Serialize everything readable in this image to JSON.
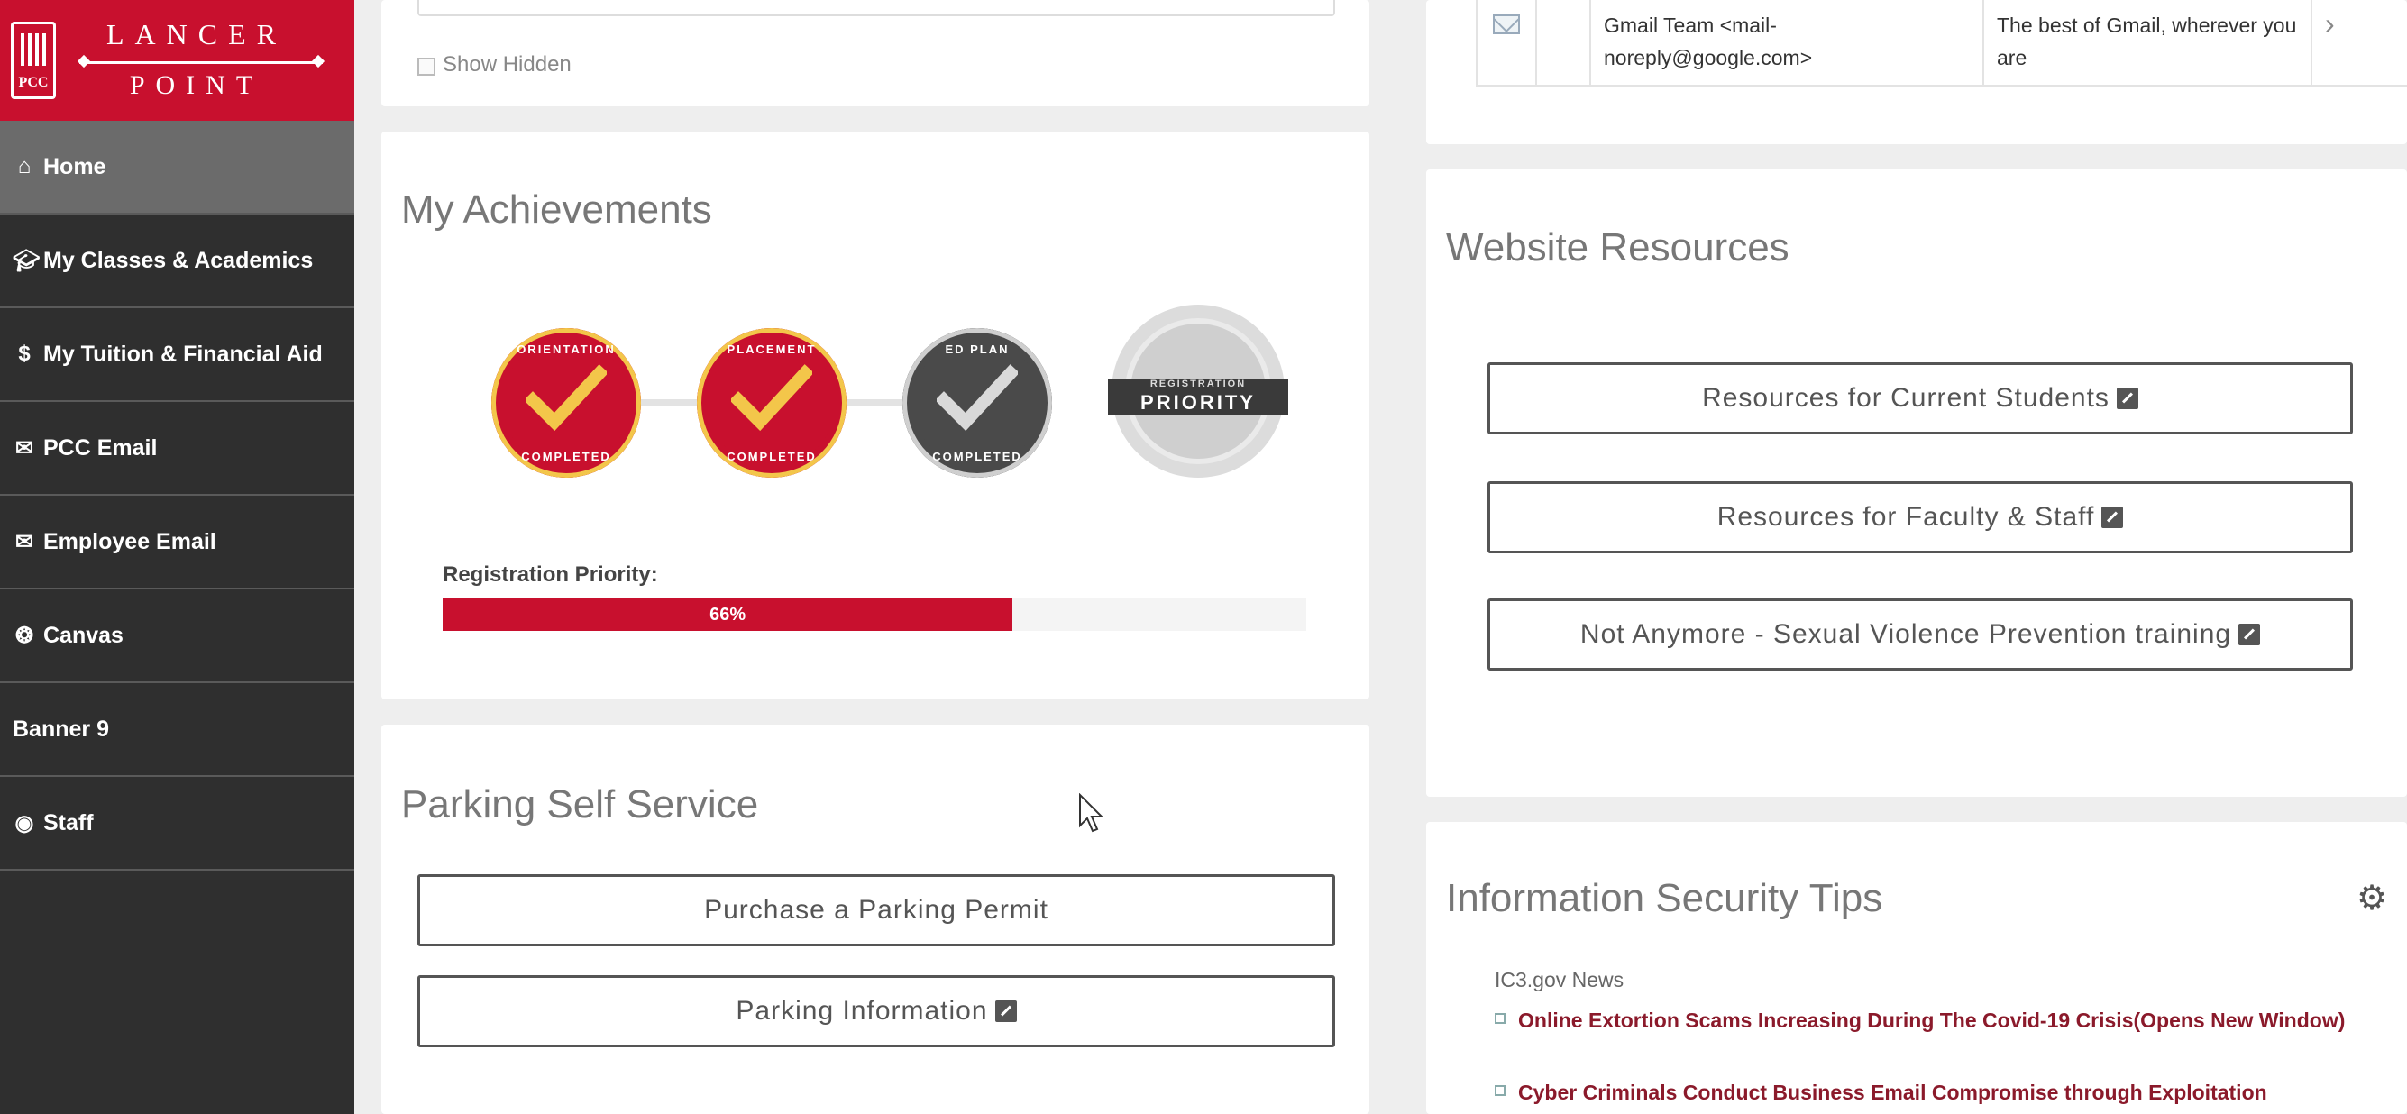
{
  "brand": {
    "line1": "LANCER",
    "line2": "POINT",
    "seal_text": "PCC",
    "color": "#c8102e"
  },
  "sidebar": {
    "items": [
      {
        "label": "Home",
        "icon": "home-icon",
        "active": true
      },
      {
        "label": "My Classes & Academics",
        "icon": "graduation-cap-icon"
      },
      {
        "label": "My Tuition & Financial Aid",
        "icon": "dollar-icon"
      },
      {
        "label": "PCC Email",
        "icon": "envelope-icon"
      },
      {
        "label": "Employee Email",
        "icon": "envelope-outline-icon"
      },
      {
        "label": "Canvas",
        "icon": "canvas-icon"
      },
      {
        "label": "Banner 9",
        "icon": ""
      },
      {
        "label": "Staff",
        "icon": "user-circle-icon"
      }
    ]
  },
  "top_card": {
    "show_hidden_label": "Show Hidden"
  },
  "achievements": {
    "title": "My Achievements",
    "badges": [
      {
        "top": "ORIENTATION",
        "bottom": "COMPLETED",
        "status": "completed"
      },
      {
        "top": "PLACEMENT",
        "bottom": "COMPLETED",
        "status": "completed"
      },
      {
        "top": "ED PLAN",
        "bottom": "COMPLETED",
        "status": "completed"
      },
      {
        "top": "REGISTRATION",
        "bottom": "PRIORITY",
        "status": "pending"
      }
    ],
    "progress_label": "Registration Priority:",
    "progress_value": 66,
    "progress_text": "66%"
  },
  "parking": {
    "title": "Parking Self Service",
    "buttons": [
      "Purchase a Parking Permit",
      "Parking Information"
    ]
  },
  "mail": {
    "from": "Gmail Team <mail-noreply@google.com>",
    "subject": "The best of Gmail, wherever you are",
    "arrow": "›"
  },
  "website_resources": {
    "title": "Website Resources",
    "links": [
      "Resources for Current Students",
      "Resources for Faculty & Staff",
      "Not Anymore - Sexual Violence Prevention training"
    ]
  },
  "security": {
    "title": "Information Security Tips",
    "source": "IC3.gov News",
    "news": [
      "Online Extortion Scams Increasing During The Covid-19 Crisis(Opens New Window)",
      "Cyber Criminals Conduct Business Email Compromise through Exploitation"
    ]
  }
}
